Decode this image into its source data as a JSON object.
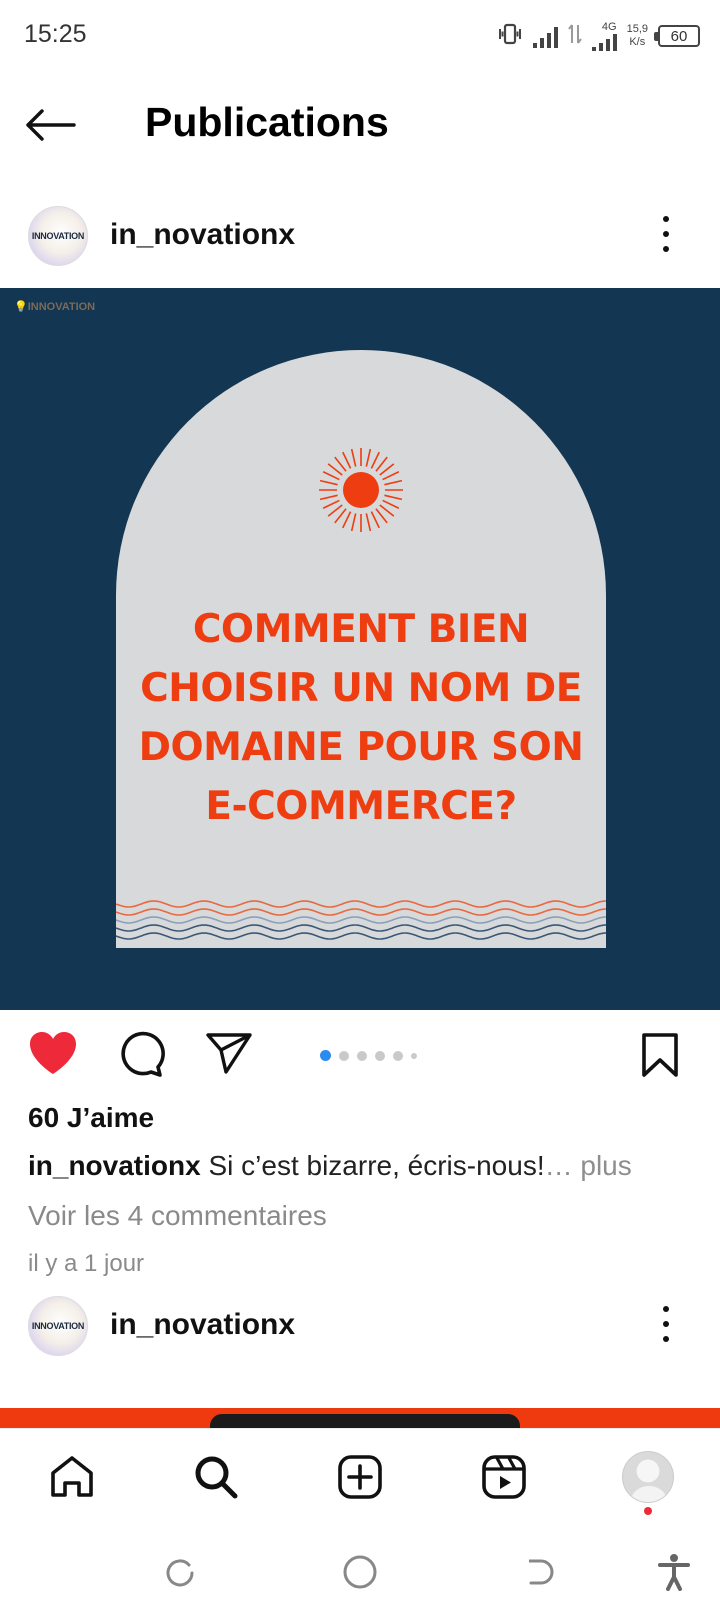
{
  "status_bar": {
    "time": "15:25",
    "network_type": "4G",
    "speed_value": "15,9",
    "speed_unit": "K/s",
    "battery_level": "60"
  },
  "header": {
    "title": "Publications"
  },
  "post": {
    "username": "in_novationx",
    "avatar_text": "INNOVATION",
    "image": {
      "logo_text": "INNOVATION",
      "headline_lines": [
        "COMMENT BIEN",
        "CHOISIR UN NOM DE",
        "DOMAINE POUR SON",
        "E-COMMERCE?"
      ],
      "background_color": "#133652",
      "arch_color": "#d7d9db",
      "accent_color": "#ee3d10"
    },
    "liked": true,
    "carousel": {
      "total": 6,
      "current": 1
    },
    "likes_text": "60 J’aime",
    "caption_user": "in_novationx",
    "caption_text": "Si c’est bizarre, écris-nous!",
    "caption_more": "… plus",
    "view_comments": "Voir les 4 commentaires",
    "time_ago": "il y a 1 jour"
  },
  "next_post": {
    "username": "in_novationx",
    "avatar_text": "INNOVATION"
  },
  "bottom_nav": {
    "items": [
      "home-icon",
      "search-icon",
      "create-icon",
      "reels-icon",
      "profile-avatar"
    ],
    "notification_color": "#ee2a3a"
  },
  "system_nav": {
    "items": [
      "recents-icon",
      "home-circle-icon",
      "back-icon",
      "accessibility-icon"
    ]
  }
}
